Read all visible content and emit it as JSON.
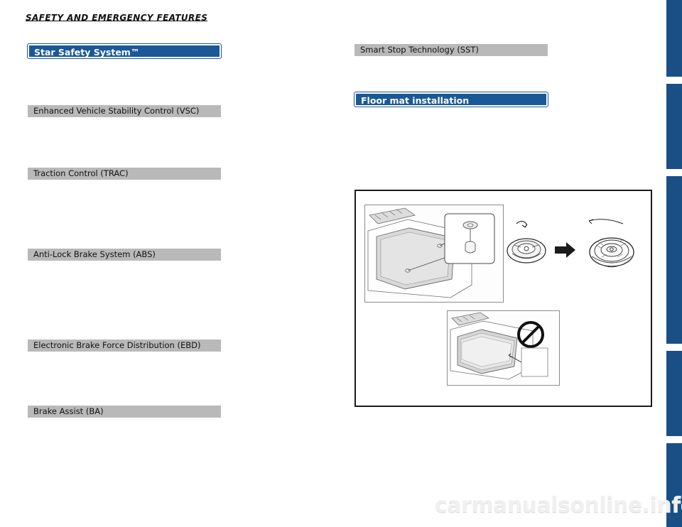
{
  "page": {
    "chapter_title": "SAFETY AND EMERGENCY FEATURES",
    "watermark": "carmanualsonline.info",
    "background_color": "#ffffff",
    "accent_blue": "#1a5896",
    "header_gray": "#b9b9b9",
    "tab_color": "#1a4f86"
  },
  "left_column": {
    "sections": [
      {
        "label": "Star Safety System™",
        "style": "blue"
      },
      {
        "label": "Enhanced Vehicle Stability Control (VSC)",
        "style": "gray"
      },
      {
        "label": "Traction Control (TRAC)",
        "style": "gray"
      },
      {
        "label": "Anti-Lock Brake System (ABS)",
        "style": "gray"
      },
      {
        "label": "Electronic Brake Force Distribution (EBD)",
        "style": "gray"
      },
      {
        "label": "Brake Assist (BA)",
        "style": "gray"
      }
    ]
  },
  "right_column": {
    "sections": [
      {
        "label": "Smart Stop Technology (SST)",
        "style": "gray"
      },
      {
        "label": "Floor mat installation",
        "style": "blue"
      }
    ],
    "figure": {
      "name": "floor-mat-installation-diagram",
      "panels": [
        {
          "name": "driver-footwell-with-retaining-hook-callout"
        },
        {
          "name": "retaining-hook-detail-before-after"
        },
        {
          "name": "incorrect-stacked-floor-mat-prohibited"
        }
      ],
      "prohibition_symbol": "no-entry-slash"
    }
  },
  "side_tabs": [
    {
      "name": "tab-1"
    },
    {
      "name": "tab-2"
    },
    {
      "name": "tab-3"
    },
    {
      "name": "tab-4"
    },
    {
      "name": "tab-5"
    }
  ]
}
